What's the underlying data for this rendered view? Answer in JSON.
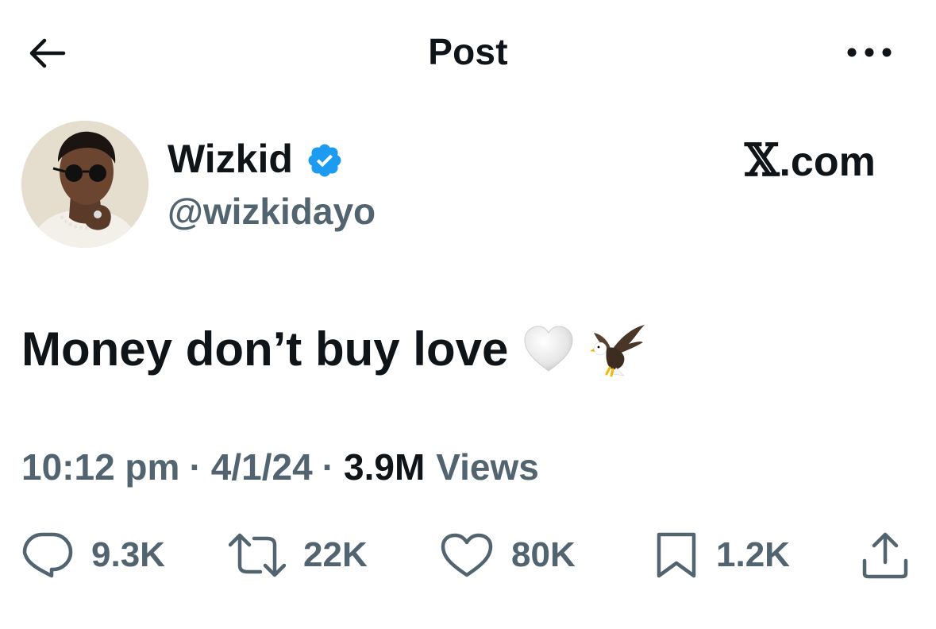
{
  "header": {
    "title": "Post",
    "back_icon": "arrow-left-icon",
    "more_icon": "more-horizontal-icon"
  },
  "author": {
    "display_name": "Wizkid",
    "handle": "@wizkidayo",
    "verified": true,
    "verified_color": "#1d9bf0"
  },
  "watermark": {
    "x_letter": "𝕏",
    "domain": ".com"
  },
  "tweet": {
    "text": "Money don’t buy love",
    "emojis": [
      "white-heart",
      "eagle"
    ]
  },
  "meta": {
    "time": "10:12 pm",
    "separator": "·",
    "date": "4/1/24",
    "views_count": "3.9M",
    "views_label": "Views"
  },
  "actions": {
    "replies": "9.3K",
    "reposts": "22K",
    "likes": "80K",
    "bookmarks": "1.2K"
  },
  "colors": {
    "text_primary": "#0f1419",
    "text_secondary": "#536471",
    "verified_blue": "#1d9bf0",
    "background": "#ffffff"
  }
}
